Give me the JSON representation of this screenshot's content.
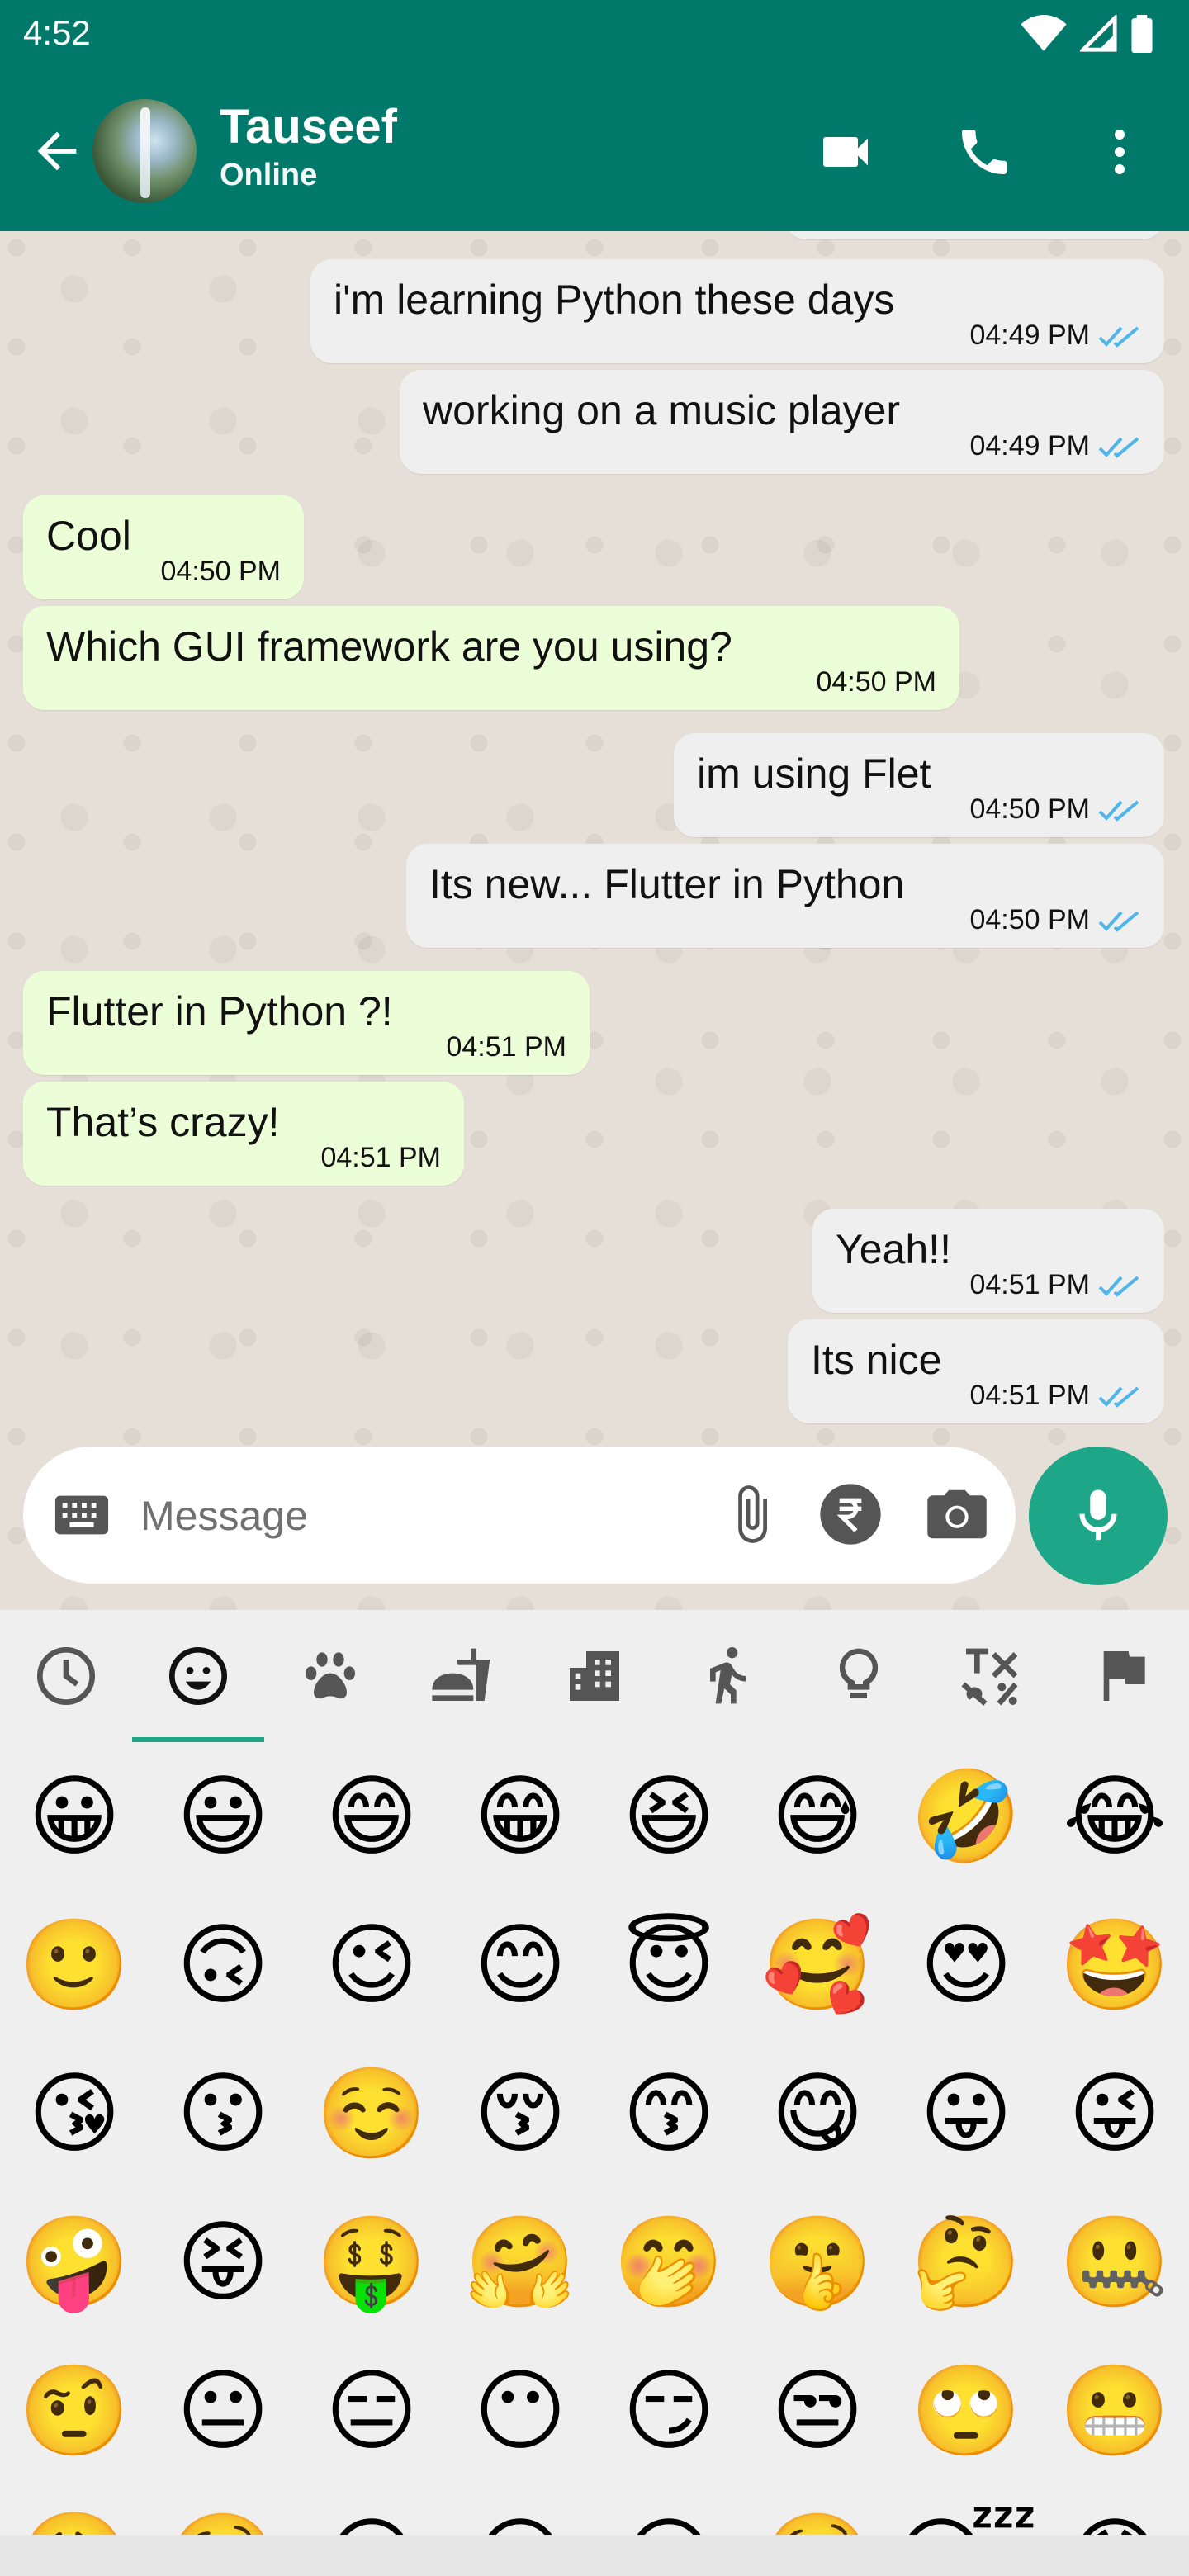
{
  "status_bar": {
    "time": "4:52"
  },
  "header": {
    "contact_name": "Tauseef",
    "contact_status": "Online"
  },
  "messages": [
    {
      "text": "i'm learning Python these days",
      "time": "04:49 PM",
      "direction": "out"
    },
    {
      "text": "working on a music player",
      "time": "04:49 PM",
      "direction": "out"
    },
    {
      "text": "Cool",
      "time": "04:50 PM",
      "direction": "in"
    },
    {
      "text": "Which GUI framework are you using?",
      "time": "04:50 PM",
      "direction": "in"
    },
    {
      "text": "im using Flet",
      "time": "04:50 PM",
      "direction": "out"
    },
    {
      "text": "Its new... Flutter in Python",
      "time": "04:50 PM",
      "direction": "out"
    },
    {
      "text": "Flutter in Python ?!",
      "time": "04:51 PM",
      "direction": "in"
    },
    {
      "text": "That’s crazy!",
      "time": "04:51 PM",
      "direction": "in"
    },
    {
      "text": "Yeah!!",
      "time": "04:51 PM",
      "direction": "out"
    },
    {
      "text": "Its nice",
      "time": "04:51 PM",
      "direction": "out"
    }
  ],
  "input": {
    "placeholder": "Message"
  },
  "emoji_categories": [
    "recent-icon",
    "smileys-icon",
    "animals-icon",
    "food-icon",
    "places-icon",
    "activity-icon",
    "objects-icon",
    "symbols-icon",
    "flags-icon"
  ],
  "emoji_rows": [
    [
      "😀",
      "😃",
      "😄",
      "😁",
      "😆",
      "😅",
      "🤣",
      "😂"
    ],
    [
      "🙂",
      "🙃",
      "😉",
      "😊",
      "😇",
      "🥰",
      "😍",
      "🤩"
    ],
    [
      "😘",
      "😗",
      "☺️",
      "😚",
      "😙",
      "😋",
      "😛",
      "😜"
    ],
    [
      "🤪",
      "😝",
      "🤑",
      "🤗",
      "🤭",
      "🤫",
      "🤔",
      "🤐"
    ],
    [
      "🤨",
      "😐",
      "😑",
      "😶",
      "😏",
      "😒",
      "🙄",
      "😬"
    ],
    [
      "😮‍💨",
      "🤥",
      "😌",
      "😔",
      "😪",
      "🤤",
      "😴",
      "😷"
    ]
  ],
  "colors": {
    "header": "#00796b",
    "incoming": "#ebfed8",
    "outgoing": "#efefef",
    "accent": "#1da688",
    "read_ticks": "#4fb6ec"
  }
}
